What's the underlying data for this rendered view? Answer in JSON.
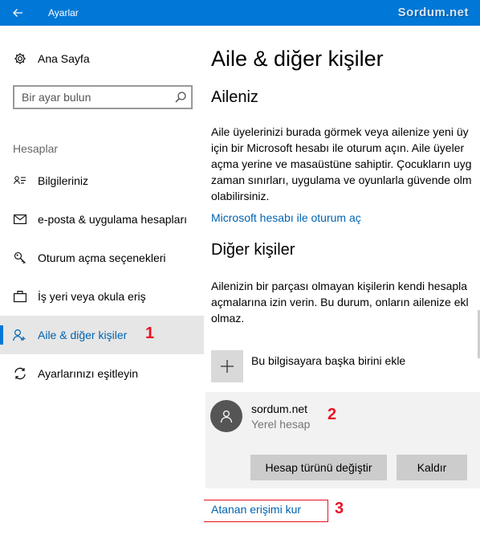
{
  "window": {
    "title": "Ayarlar",
    "watermark": "Sordum.net",
    "accent_color": "#0078d7"
  },
  "sidebar": {
    "home_label": "Ana Sayfa",
    "search_placeholder": "Bir ayar bulun",
    "section_header": "Hesaplar",
    "items": [
      {
        "label": "Bilgileriniz",
        "icon": "person-card-icon"
      },
      {
        "label": "e-posta & uygulama hesapları",
        "icon": "mail-icon"
      },
      {
        "label": "Oturum açma seçenekleri",
        "icon": "key-icon"
      },
      {
        "label": "İş yeri veya okula eriş",
        "icon": "briefcase-icon"
      },
      {
        "label": "Aile & diğer kişiler",
        "icon": "people-icon",
        "selected": true
      },
      {
        "label": "Ayarlarınızı eşitleyin",
        "icon": "sync-icon"
      }
    ]
  },
  "annotations": {
    "one": "1",
    "two": "2",
    "three": "3",
    "color": "#e81123"
  },
  "content": {
    "page_title": "Aile & diğer kişiler",
    "family": {
      "heading": "Aileniz",
      "lines": [
        "Aile üyelerinizi burada görmek veya ailenize yeni üy",
        "için bir Microsoft hesabı ile oturum açın. Aile üyeler",
        "açma yerine ve masaüstüne sahiptir. Çocukların uyg",
        "zaman sınırları, uygulama ve oyunlarla güvende olm",
        "olabilirsiniz."
      ],
      "signin_link": "Microsoft hesabı ile oturum aç"
    },
    "others": {
      "heading": "Diğer kişiler",
      "lines": [
        "Ailenizin bir parçası olmayan kişilerin kendi hesapla",
        "açmalarına izin verin. Bu durum, onların ailenize ekl",
        "olmaz."
      ],
      "add_label": "Bu bilgisayara başka birini ekle",
      "account": {
        "name": "sordum.net",
        "type": "Yerel hesap",
        "change_button": "Hesap türünü değiştir",
        "remove_button": "Kaldır"
      }
    },
    "assigned_access_link": "Atanan erişimi kur"
  }
}
